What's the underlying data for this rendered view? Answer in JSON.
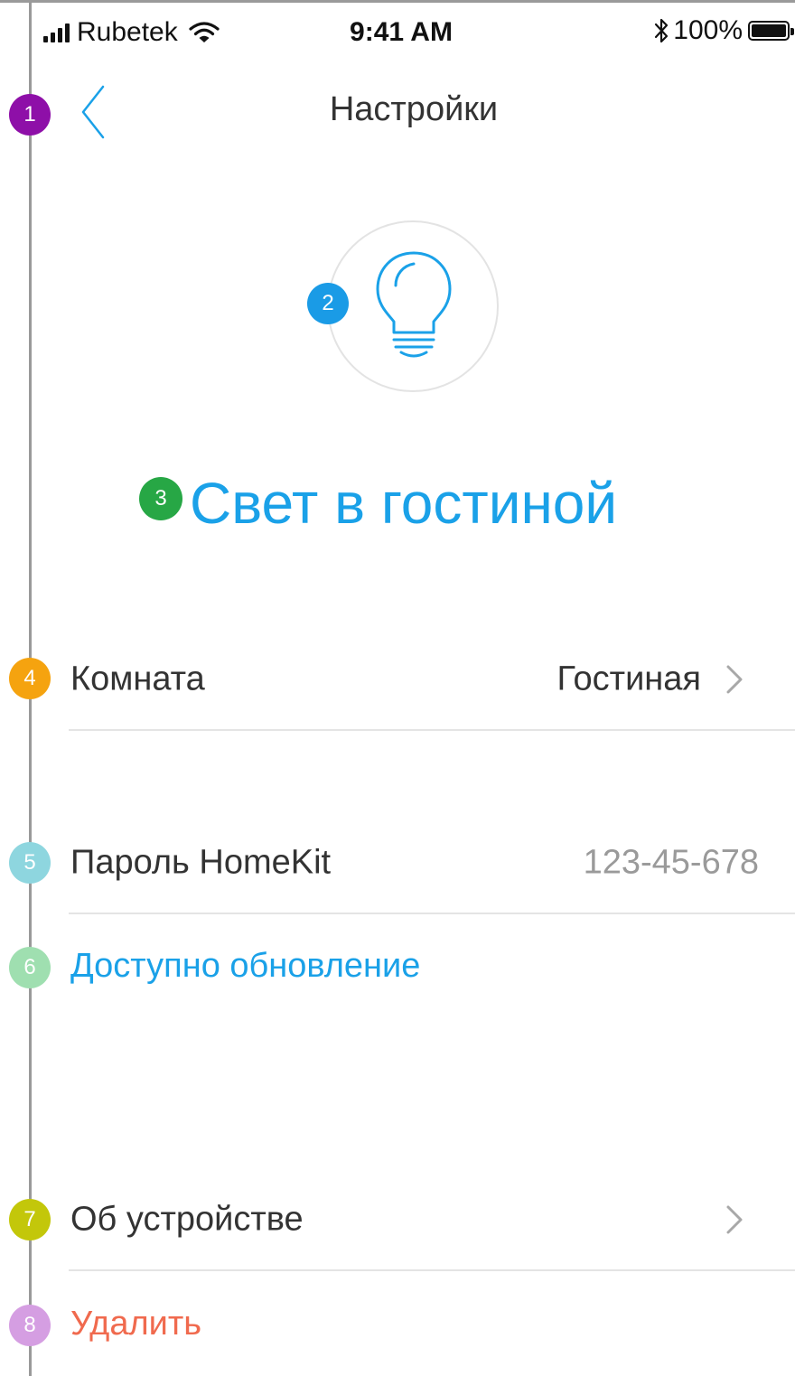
{
  "status_bar": {
    "carrier": "Rubetek",
    "time": "9:41 AM",
    "battery_text": "100%",
    "battery_level": 1.0,
    "icons": [
      "signal-bars-icon",
      "wifi-icon",
      "bluetooth-icon",
      "battery-icon"
    ]
  },
  "header": {
    "title": "Настройки",
    "back_icon": "chevron-left-icon"
  },
  "device": {
    "icon": "light-bulb-icon",
    "name": "Свет в гостиной"
  },
  "rows": {
    "room": {
      "label": "Комната",
      "value": "Гостиная",
      "icon": "chevron-right-icon"
    },
    "homekit": {
      "label": "Пароль HomeKit",
      "value": "123-45-678"
    },
    "update": {
      "label": "Доступно обновление"
    },
    "about": {
      "label": "Об устройстве",
      "icon": "chevron-right-icon"
    },
    "delete": {
      "label": "Удалить"
    }
  },
  "annotations": {
    "items": [
      {
        "number": "1",
        "color": "#8e0fa8"
      },
      {
        "number": "2",
        "color": "#1a9be6"
      },
      {
        "number": "3",
        "color": "#27a745"
      },
      {
        "number": "4",
        "color": "#f5a30f"
      },
      {
        "number": "5",
        "color": "#8ed6df"
      },
      {
        "number": "6",
        "color": "#9fdfb0"
      },
      {
        "number": "7",
        "color": "#c3c70a"
      },
      {
        "number": "8",
        "color": "#d59ee2"
      }
    ]
  },
  "colors": {
    "accent": "#1aa1e8",
    "danger": "#f06a4e",
    "muted_text": "#9a9a9a",
    "primary_text": "#333333",
    "divider": "#e4e4e4"
  }
}
